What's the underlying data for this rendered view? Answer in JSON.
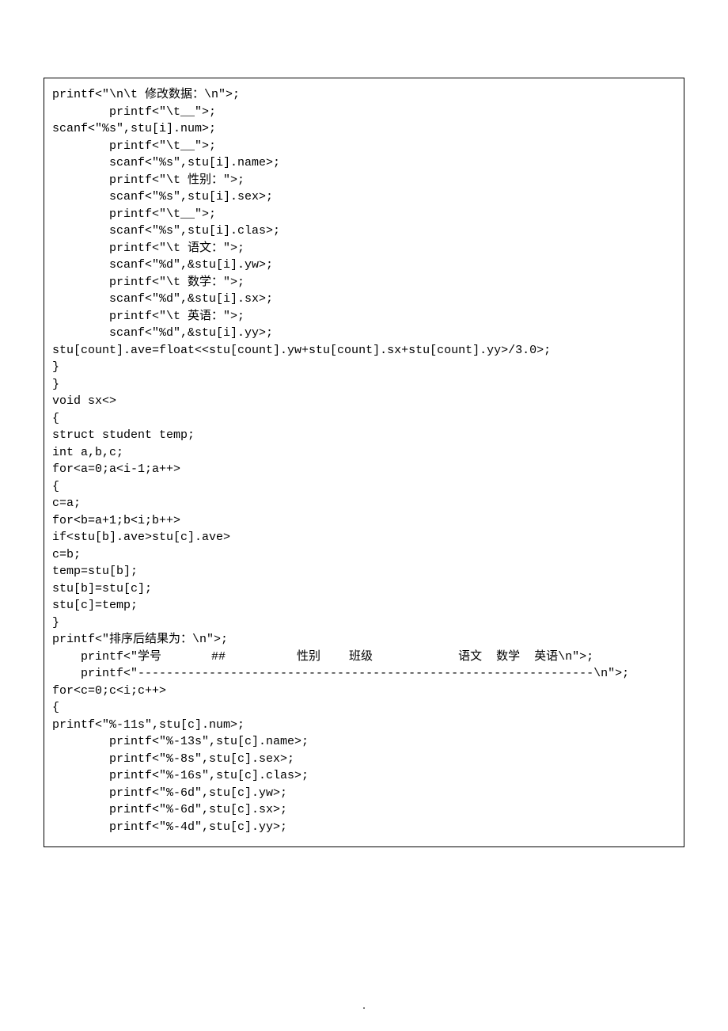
{
  "lines": [
    "printf<\"\\n\\t 修改数据：\\n\">;",
    "        printf<\"\\t__\">;",
    "scanf<\"%s\",stu[i].num>;",
    "        printf<\"\\t__\">;",
    "        scanf<\"%s\",stu[i].name>;",
    "        printf<\"\\t 性别：\">;",
    "        scanf<\"%s\",stu[i].sex>;",
    "        printf<\"\\t__\">;",
    "        scanf<\"%s\",stu[i].clas>;",
    "        printf<\"\\t 语文：\">;",
    "        scanf<\"%d\",&stu[i].yw>;",
    "        printf<\"\\t 数学：\">;",
    "        scanf<\"%d\",&stu[i].sx>;",
    "        printf<\"\\t 英语：\">;",
    "        scanf<\"%d\",&stu[i].yy>;",
    "stu[count].ave=float<<stu[count].yw+stu[count].sx+stu[count].yy>/3.0>;",
    "}",
    "}",
    "void sx<>",
    "{",
    "struct student temp;",
    "int a,b,c;",
    "for<a=0;a<i-1;a++>",
    "{",
    "c=a;",
    "for<b=a+1;b<i;b++>",
    "if<stu[b].ave>stu[c].ave>",
    "c=b;",
    "temp=stu[b];",
    "stu[b]=stu[c];",
    "stu[c]=temp;",
    "}",
    "printf<\"排序后结果为：\\n\">;",
    "    printf<\"学号       ##          性别    班级            语文  数学  英语\\n\">;",
    "    printf<\"----------------------------------------------------------------\\n\">;",
    "for<c=0;c<i;c++>",
    "{",
    "printf<\"%-11s\",stu[c].num>;",
    "        printf<\"%-13s\",stu[c].name>;",
    "        printf<\"%-8s\",stu[c].sex>;",
    "        printf<\"%-16s\",stu[c].clas>;",
    "        printf<\"%-6d\",stu[c].yw>;",
    "        printf<\"%-6d\",stu[c].sx>;",
    "        printf<\"%-4d\",stu[c].yy>;"
  ],
  "footer": "."
}
